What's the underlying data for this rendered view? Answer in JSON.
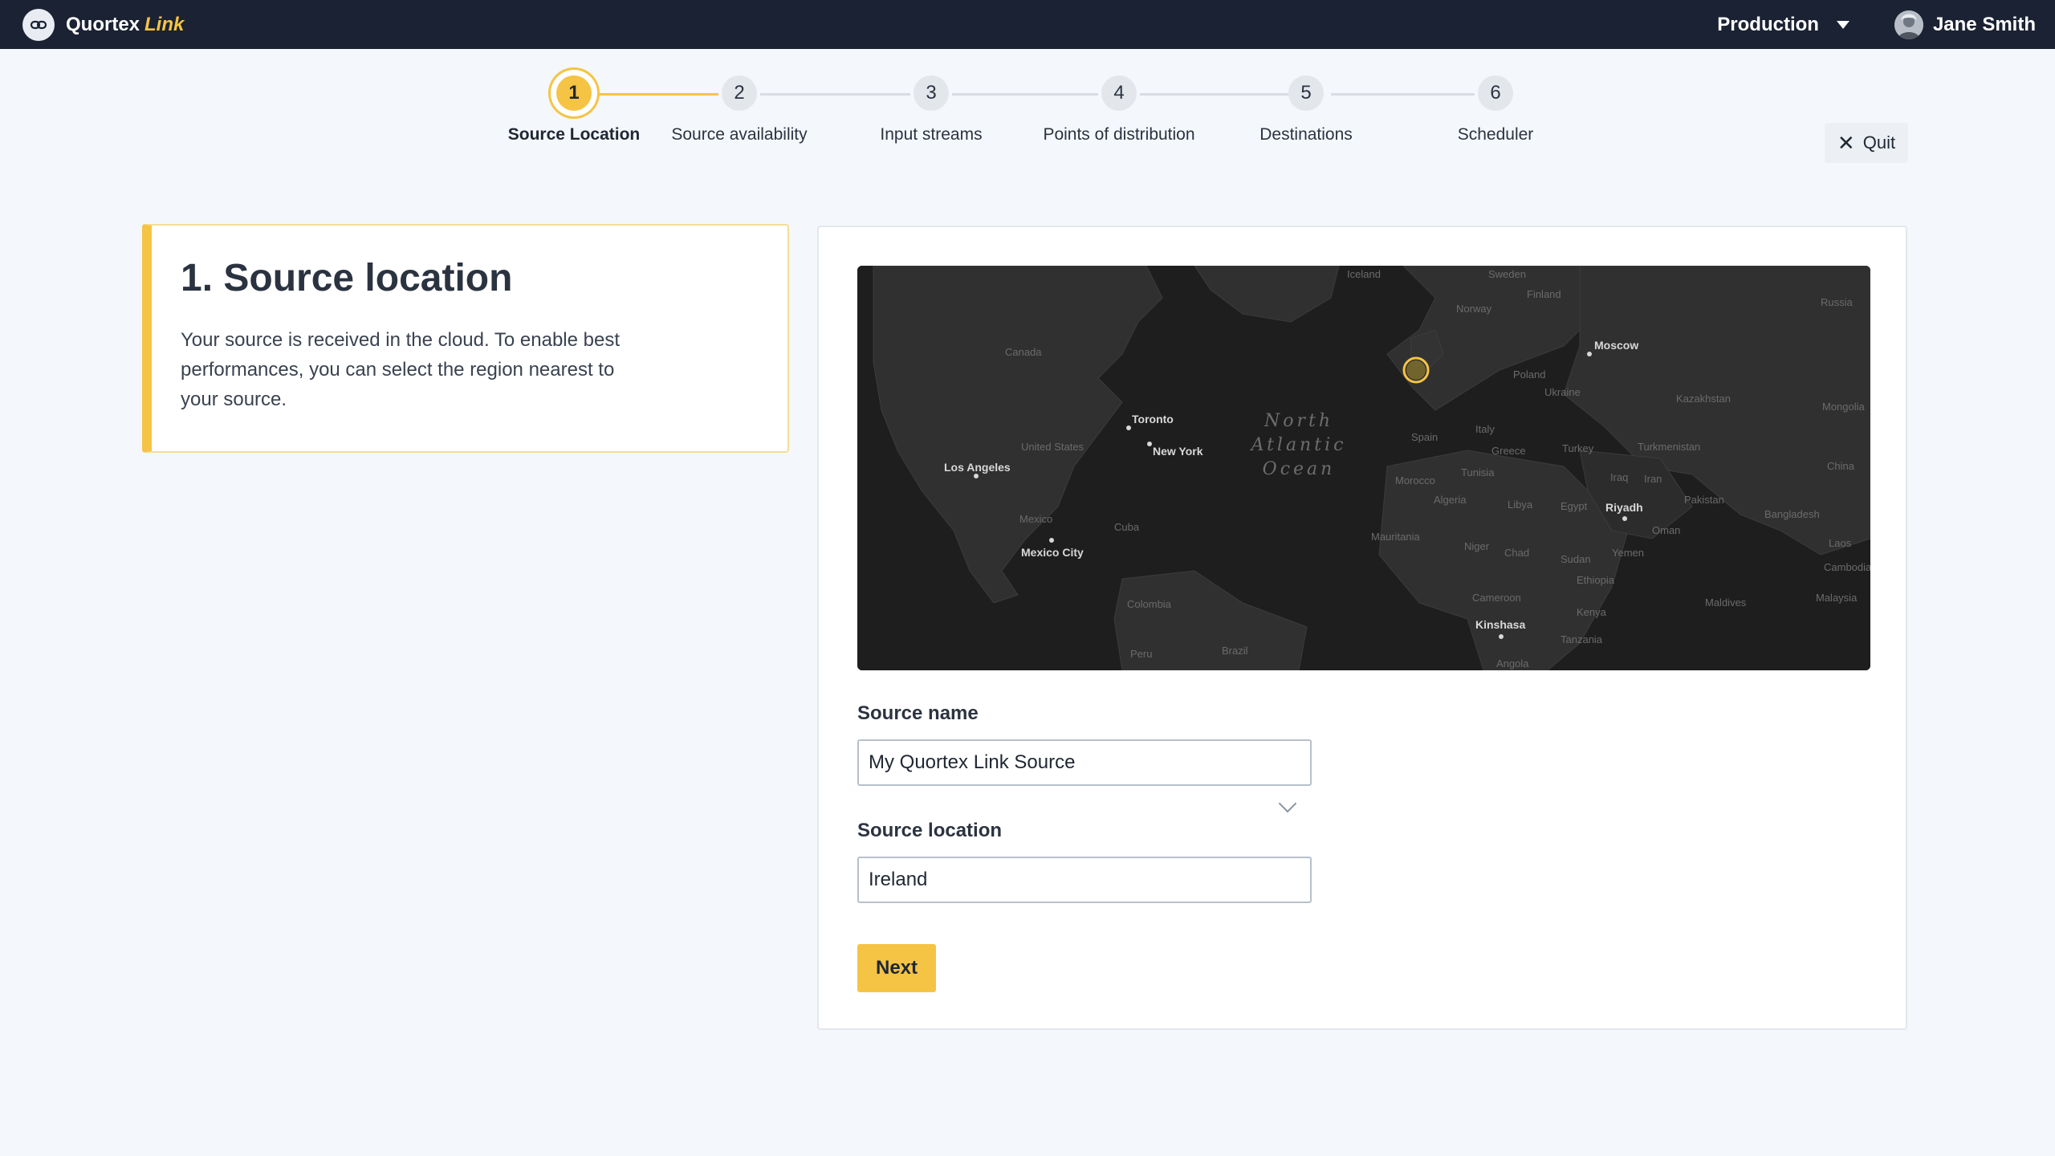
{
  "app": {
    "brand": "Quortex",
    "brand_accent": "Link"
  },
  "header": {
    "environment": "Production",
    "user_name": "Jane Smith"
  },
  "stepper": {
    "steps": [
      {
        "number": "1",
        "label": "Source Location",
        "active": true
      },
      {
        "number": "2",
        "label": "Source availability",
        "active": false
      },
      {
        "number": "3",
        "label": "Input streams",
        "active": false
      },
      {
        "number": "4",
        "label": "Points of distribution",
        "active": false
      },
      {
        "number": "5",
        "label": "Destinations",
        "active": false
      },
      {
        "number": "6",
        "label": "Scheduler",
        "active": false
      }
    ]
  },
  "quit": {
    "label": "Quit"
  },
  "info": {
    "title": "1. Source location",
    "description": "Your source is received in the cloud. To enable best performances, you can select the region nearest to your source."
  },
  "map": {
    "ocean_label": [
      "North",
      "Atlantic",
      "Ocean"
    ],
    "region_labels": [
      "Iceland",
      "Sweden",
      "Finland",
      "Norway",
      "Russia",
      "Canada",
      "Moscow",
      "Poland",
      "Ukraine",
      "Kazakhstan",
      "Mongolia",
      "United States",
      "Italy",
      "Greece",
      "Turkey",
      "Turkmenistan",
      "China",
      "Spain",
      "Iraq",
      "Iran",
      "Morocco",
      "Tunisia",
      "Algeria",
      "Libya",
      "Egypt",
      "Pakistan",
      "Bangladesh",
      "Mexico",
      "Cuba",
      "Oman",
      "Mauritania",
      "Niger",
      "Chad",
      "Sudan",
      "Yemen",
      "Ethiopia",
      "Colombia",
      "Cameroon",
      "Kenya",
      "Maldives",
      "Malaysia",
      "Peru",
      "Brazil",
      "Tanzania",
      "Angola",
      "Laos",
      "Cambodia"
    ],
    "cities": [
      "Toronto",
      "New York",
      "Los Angeles",
      "Mexico City",
      "Riyadh",
      "Kinshasa",
      "Moscow"
    ],
    "marker_color": "#f5c445"
  },
  "form": {
    "source_name_label": "Source name",
    "source_name_value": "My Quortex Link Source",
    "source_location_label": "Source location",
    "source_location_value": "Ireland",
    "next_label": "Next"
  }
}
